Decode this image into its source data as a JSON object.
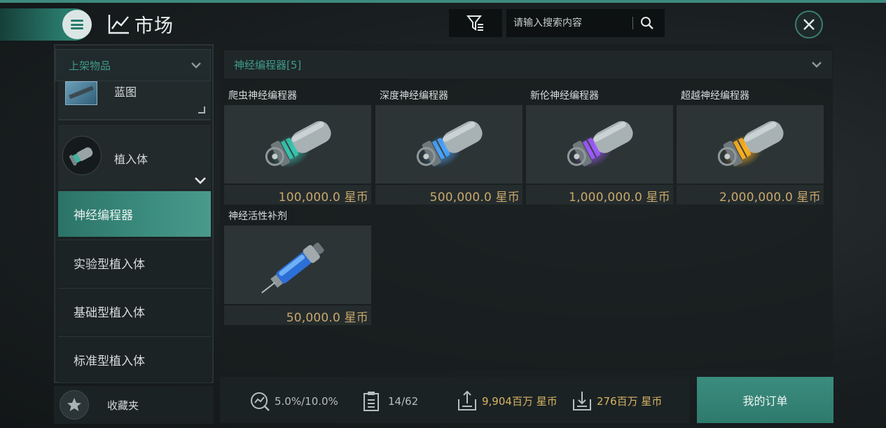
{
  "header": {
    "title": "市场",
    "search_placeholder": "请输入搜索内容",
    "icons": [
      "menu-icon",
      "market-chart-icon",
      "filter-icon",
      "search-icon",
      "close-icon"
    ]
  },
  "sidebar": {
    "listed_dropdown": "上架物品",
    "categories": [
      {
        "label": "蓝图",
        "icon": "blueprint-icon"
      },
      {
        "label": "植入体",
        "icon": "implant-icon"
      }
    ],
    "sub_items": [
      {
        "label": "神经编程器",
        "active": true
      },
      {
        "label": "实验型植入体",
        "active": false
      },
      {
        "label": "基础型植入体",
        "active": false
      },
      {
        "label": "标准型植入体",
        "active": false
      }
    ],
    "favorites": {
      "label": "收藏夹",
      "icon": "star-icon"
    }
  },
  "main": {
    "group_dropdown": "神经编程器[5]",
    "items": [
      {
        "name": "爬虫神经编程器",
        "price": "100,000.0 星币",
        "glow": "#35c9b0"
      },
      {
        "name": "深度神经编程器",
        "price": "500,000.0 星币",
        "glow": "#4aa5ff"
      },
      {
        "name": "新伦神经编程器",
        "price": "1,000,000.0 星币",
        "glow": "#a05bff"
      },
      {
        "name": "超越神经编程器",
        "price": "2,000,000.0 星币",
        "glow": "#ffb21e"
      },
      {
        "name": "神经活性补剂",
        "price": "50,000.0 星币",
        "glow": "#3f9cff"
      }
    ]
  },
  "bottom_bar": {
    "tax": "5.0%/10.0%",
    "orders_count": "14/62",
    "sell_total": "9,904百万 星币",
    "buy_total": "276百万 星币",
    "my_orders_button": "我的订单"
  },
  "colors": {
    "accent": "#3e9a88",
    "price_gold": "#c9a86a",
    "stat_gold": "#d7b563"
  }
}
